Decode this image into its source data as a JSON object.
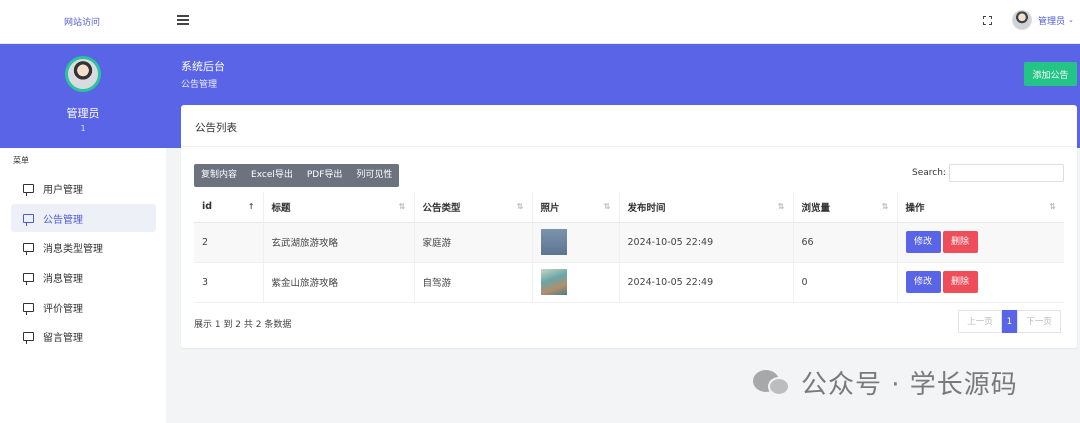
{
  "topbar": {
    "site_link": "网站访问",
    "user_name": "管理员",
    "caret": "⌄"
  },
  "sidebar": {
    "name": "管理员",
    "sub": "1",
    "menu_title": "菜单",
    "items": [
      {
        "label": "用户管理"
      },
      {
        "label": "公告管理"
      },
      {
        "label": "消息类型管理"
      },
      {
        "label": "消息管理"
      },
      {
        "label": "评价管理"
      },
      {
        "label": "留言管理"
      }
    ],
    "active_index": 1
  },
  "header": {
    "title": "系统后台",
    "breadcrumb": "公告管理",
    "add_button": "添加公告"
  },
  "card": {
    "title": "公告列表",
    "export_buttons": [
      "复制内容",
      "Excel导出",
      "PDF导出",
      "列可见性"
    ],
    "search_label": "Search:",
    "search_value": ""
  },
  "table": {
    "columns": [
      "id",
      "标题",
      "公告类型",
      "照片",
      "发布时间",
      "浏览量",
      "操作"
    ],
    "rows": [
      {
        "id": "2",
        "title": "玄武湖旅游攻略",
        "type": "家庭游",
        "photo": "blue-thumbnail",
        "time": "2024-10-05 22:49",
        "views": "66"
      },
      {
        "id": "3",
        "title": "紫金山旅游攻略",
        "type": "自驾游",
        "photo": "lake-thumbnail",
        "time": "2024-10-05 22:49",
        "views": "0"
      }
    ],
    "edit_label": "修改",
    "delete_label": "删除"
  },
  "footer": {
    "info": "展示 1 到 2 共 2 条数据",
    "prev": "上一页",
    "current": "1",
    "next": "下一页"
  },
  "watermark": {
    "text": "公众号 · 学长源码"
  },
  "colors": {
    "primary": "#5a64e6",
    "success": "#23c586",
    "danger": "#ef4d5a",
    "export_gray": "#6c737f"
  },
  "icons": {
    "menu": "hamburger-icon",
    "fullscreen": "fullscreen-icon",
    "menu_item": "chat-bubble-icon",
    "sort": "sort-arrows-icon"
  }
}
